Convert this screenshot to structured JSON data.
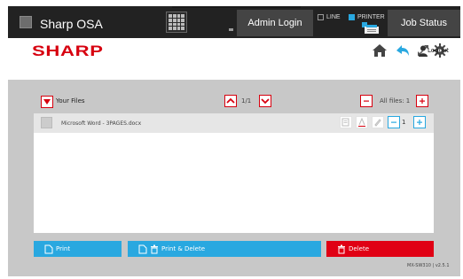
{
  "topbar": {
    "app_title": "Sharp OSA",
    "admin_login_label": "Admin Login",
    "line_label": "LINE",
    "printer_label": "PRINTER",
    "job_status_label": "Job Status"
  },
  "header": {
    "logo_text": "SHARP",
    "logout_label": "Logout",
    "icons": [
      "home-icon",
      "back-arrow-icon",
      "expand-icon",
      "gear-icon",
      "user-icon"
    ]
  },
  "files": {
    "title": "Your Files",
    "page_indicator": "1/1",
    "all_files_label": "All files: 1",
    "rows": [
      {
        "name": "Microsoft Word - 3PAGES.docx",
        "count": "1"
      }
    ]
  },
  "actions": {
    "print_label": "Print",
    "print_delete_label": "Print & Delete",
    "delete_label": "Delete"
  },
  "footer": {
    "version": "MX-SW310 | v2.5.1"
  },
  "colors": {
    "accent_red": "#d7000f",
    "accent_blue": "#29a8e0",
    "delete_red": "#e00014",
    "topbar_bg": "#222222",
    "content_bg": "#c8c8c8"
  }
}
